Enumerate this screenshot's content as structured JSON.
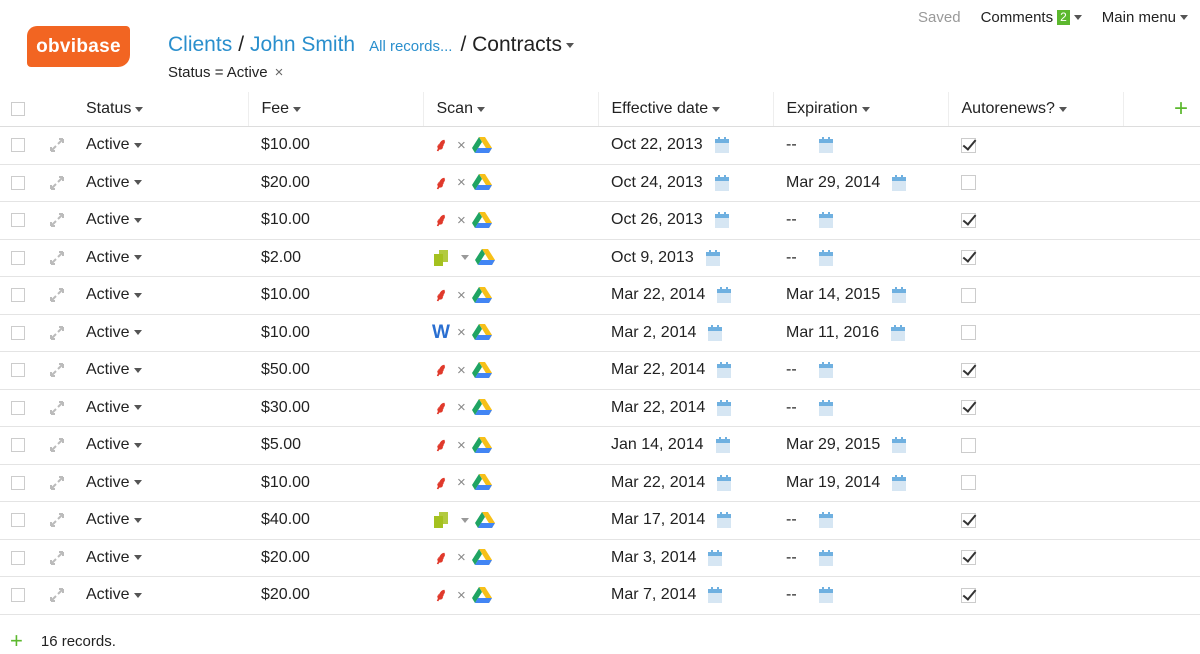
{
  "header": {
    "saved_label": "Saved",
    "comments_label": "Comments",
    "comments_count": "2",
    "main_menu_label": "Main menu",
    "logo_text": "obvibase"
  },
  "breadcrumb": {
    "clients": "Clients",
    "separator": "/",
    "client_name": "John Smith",
    "all_records": "All records...",
    "current": "/ Contracts"
  },
  "filter": {
    "label": "Status = Active",
    "remove": "×"
  },
  "columns": {
    "status": "Status",
    "fee": "Fee",
    "scan": "Scan",
    "effective": "Effective date",
    "expiration": "Expiration",
    "autorenews": "Autorenews?"
  },
  "rows": [
    {
      "status": "Active",
      "fee": "$10.00",
      "scan": "pdf",
      "effective": "Oct 22, 2013",
      "expiration": "--",
      "autorenews": true
    },
    {
      "status": "Active",
      "fee": "$20.00",
      "scan": "pdf",
      "effective": "Oct 24, 2013",
      "expiration": "Mar 29, 2014",
      "autorenews": false
    },
    {
      "status": "Active",
      "fee": "$10.00",
      "scan": "pdf",
      "effective": "Oct 26, 2013",
      "expiration": "--",
      "autorenews": true
    },
    {
      "status": "Active",
      "fee": "$2.00",
      "scan": "clip",
      "effective": "Oct 9, 2013",
      "expiration": "--",
      "autorenews": true
    },
    {
      "status": "Active",
      "fee": "$10.00",
      "scan": "pdf",
      "effective": "Mar 22, 2014",
      "expiration": "Mar 14, 2015",
      "autorenews": false
    },
    {
      "status": "Active",
      "fee": "$10.00",
      "scan": "word",
      "effective": "Mar 2, 2014",
      "expiration": "Mar 11, 2016",
      "autorenews": false
    },
    {
      "status": "Active",
      "fee": "$50.00",
      "scan": "pdf",
      "effective": "Mar 22, 2014",
      "expiration": "--",
      "autorenews": true
    },
    {
      "status": "Active",
      "fee": "$30.00",
      "scan": "pdf",
      "effective": "Mar 22, 2014",
      "expiration": "--",
      "autorenews": true
    },
    {
      "status": "Active",
      "fee": "$5.00",
      "scan": "pdf",
      "effective": "Jan 14, 2014",
      "expiration": "Mar 29, 2015",
      "autorenews": false
    },
    {
      "status": "Active",
      "fee": "$10.00",
      "scan": "pdf",
      "effective": "Mar 22, 2014",
      "expiration": "Mar 19, 2014",
      "autorenews": false
    },
    {
      "status": "Active",
      "fee": "$40.00",
      "scan": "clip",
      "effective": "Mar 17, 2014",
      "expiration": "--",
      "autorenews": true
    },
    {
      "status": "Active",
      "fee": "$20.00",
      "scan": "pdf",
      "effective": "Mar 3, 2014",
      "expiration": "--",
      "autorenews": true
    },
    {
      "status": "Active",
      "fee": "$20.00",
      "scan": "pdf",
      "effective": "Mar 7, 2014",
      "expiration": "--",
      "autorenews": true
    }
  ],
  "footer": {
    "records": "16 records."
  },
  "icons": {
    "pdf": "pdf-icon",
    "word": "word-doc-icon",
    "clip": "clipboard-icon",
    "drive": "google-drive-icon",
    "calendar": "calendar-icon",
    "expand": "expand-icon"
  },
  "colors": {
    "accent": "#2a8fcd",
    "logo": "#f26522",
    "add": "#5cb82e",
    "pdf": "#e0392b"
  }
}
